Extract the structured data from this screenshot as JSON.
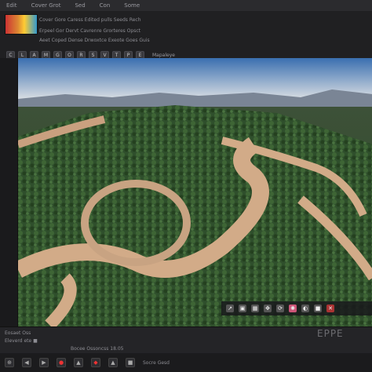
{
  "menubar": {
    "items": [
      "Edit",
      "Cover Grot",
      "Sed",
      "Con",
      "Some"
    ]
  },
  "info_rows": [
    "Cover Gore  Caress Edited pulls Seeds Rech",
    "Erpeel Gor Dervt Cavrenre  Grorteres Opsct",
    "Aeet Coped Dense Drwoxtce Exeote Goes Guis"
  ],
  "toolbar": {
    "buttons": [
      "C",
      "L",
      "A",
      "M",
      "G",
      "O",
      "R",
      "S",
      "V",
      "T",
      "P",
      "E"
    ],
    "label": "Mapaleye"
  },
  "viewport_tools": {
    "icons": [
      "arrow-icon",
      "cube-icon",
      "grid-icon",
      "move-icon",
      "orbit-icon",
      "light-icon",
      "render-icon",
      "camera-icon",
      "close-icon"
    ],
    "glyphs": [
      "↗",
      "▣",
      "▦",
      "✥",
      "⟳",
      "✺",
      "◐",
      "■",
      "✕"
    ]
  },
  "viewport_watermark": "EPPE",
  "timeline": {
    "row1": "Eosaet Oss",
    "row2": "Eleverd ete ■",
    "row3": "Bocee Ossoncss 18.05"
  },
  "statusbar": {
    "buttons": [
      "⊕",
      "◀",
      "▶",
      "●",
      "▲",
      "◆",
      "▲",
      "■"
    ],
    "label": "Socre Gesd"
  },
  "colors": {
    "sky_top": "#3a6fb0",
    "sky_horizon": "#d8dde2",
    "forest": "#2f4f2c",
    "path": "#d2ab88",
    "ui_bg": "#202022"
  }
}
